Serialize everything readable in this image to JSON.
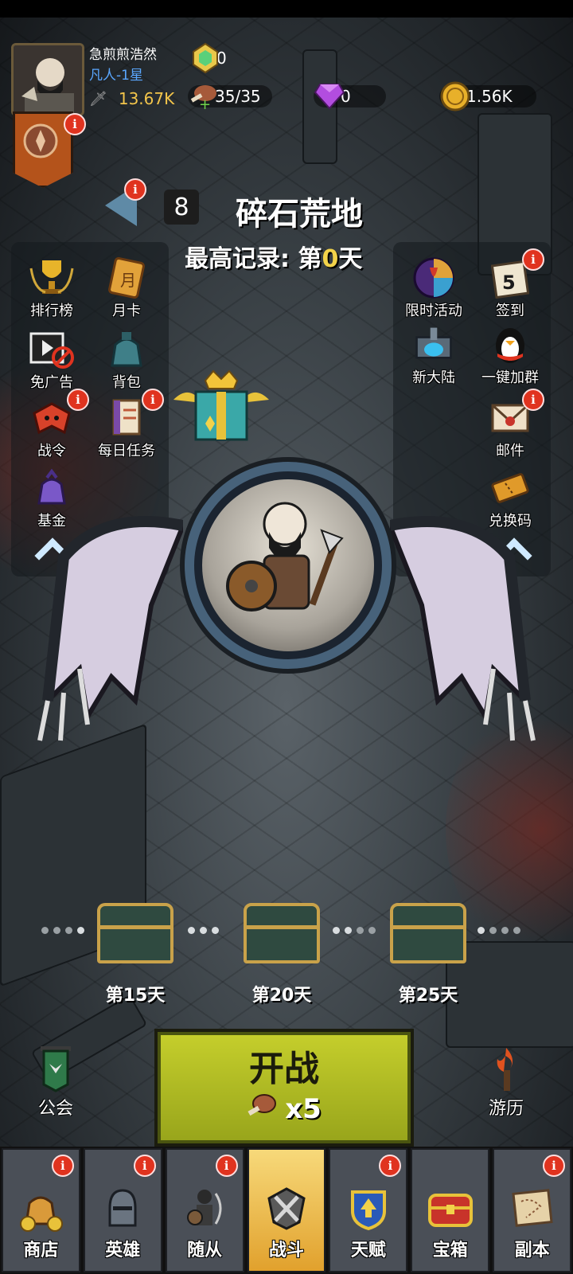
{
  "player": {
    "name": "急煎煎浩然",
    "rank": "凡人-1星",
    "power": "13.67K"
  },
  "resources": {
    "gem": "0",
    "stamina": "35/35",
    "diamond": "0",
    "gold": "1.56K"
  },
  "stage": {
    "number": "8",
    "title": "碎石荒地",
    "best_prefix": "最高记录: 第",
    "best_value": "0",
    "best_suffix": "天"
  },
  "left_menu": [
    {
      "label": "排行榜",
      "icon": "trophy-icon"
    },
    {
      "label": "月卡",
      "icon": "month-card-icon"
    },
    {
      "label": "免广告",
      "icon": "no-ads-icon"
    },
    {
      "label": "背包",
      "icon": "backpack-icon"
    },
    {
      "label": "战令",
      "icon": "battle-pass-icon"
    },
    {
      "label": "每日任务",
      "icon": "daily-task-icon"
    },
    {
      "label": "基金",
      "icon": "fund-icon"
    }
  ],
  "right_menu": [
    {
      "label": "限时活动",
      "icon": "wheel-icon"
    },
    {
      "label": "签到",
      "icon": "calendar-icon",
      "calendar_day": "5"
    },
    {
      "label": "新大陆",
      "icon": "portal-icon"
    },
    {
      "label": "一键加群",
      "icon": "penguin-icon"
    },
    {
      "label": "邮件",
      "icon": "mail-icon"
    },
    {
      "label": "兑换码",
      "icon": "ticket-icon"
    }
  ],
  "milestones": [
    {
      "label": "第15天"
    },
    {
      "label": "第20天"
    },
    {
      "label": "第25天"
    }
  ],
  "start": {
    "label": "开战",
    "cost": "x5"
  },
  "guild_label": "公会",
  "travel_label": "游历",
  "nav": [
    {
      "label": "商店",
      "icon": "coin-bag-icon"
    },
    {
      "label": "英雄",
      "icon": "knight-helmet-icon"
    },
    {
      "label": "随从",
      "icon": "follower-icon"
    },
    {
      "label": "战斗",
      "icon": "crossed-swords-icon"
    },
    {
      "label": "天赋",
      "icon": "talent-shield-icon"
    },
    {
      "label": "宝箱",
      "icon": "treasure-chest-icon"
    },
    {
      "label": "副本",
      "icon": "map-scroll-icon"
    }
  ],
  "badge_text": "i",
  "colors": {
    "accent_gold": "#f3c54b",
    "rank_blue": "#5aa7ff",
    "start_green": "#b4c02a",
    "badge_red": "#e0331f"
  }
}
